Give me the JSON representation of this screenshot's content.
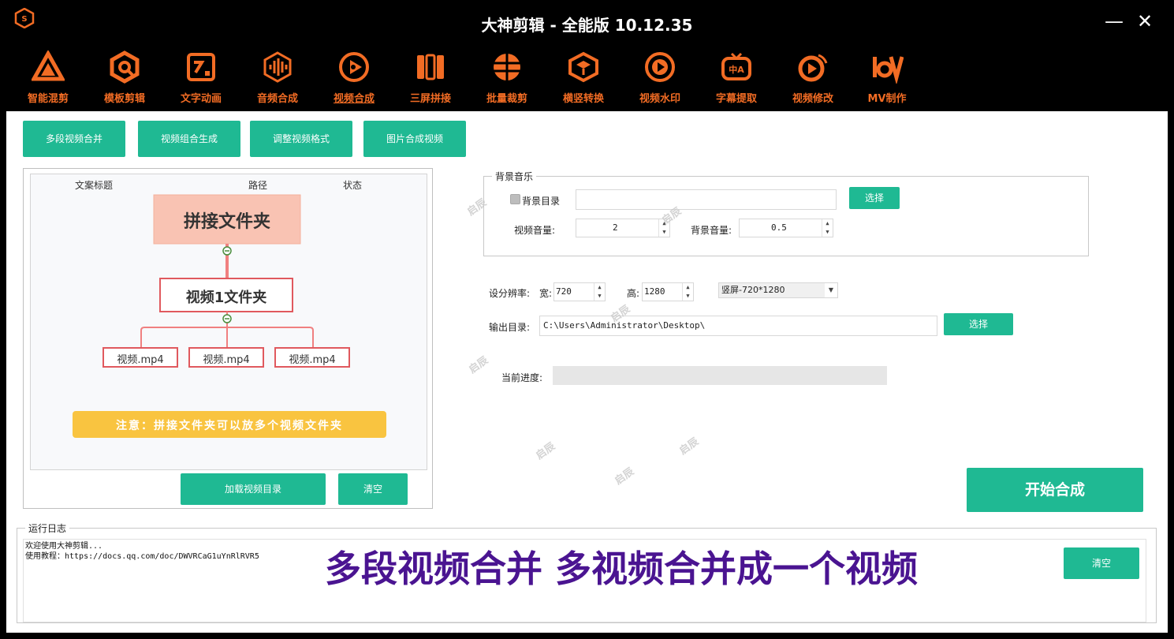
{
  "window": {
    "title": "大神剪辑 - 全能版 10.12.35",
    "minimize_label": "—",
    "close_label": "✕"
  },
  "toolbar": {
    "accent": "#f26c24",
    "items": [
      {
        "label": "智能混剪",
        "icon": "triangle-logo-icon"
      },
      {
        "label": "模板剪辑",
        "icon": "hexagon-q-icon"
      },
      {
        "label": "文字动画",
        "icon": "text-frame-icon"
      },
      {
        "label": "音频合成",
        "icon": "waveform-hexagon-icon"
      },
      {
        "label": "视频合成",
        "icon": "play-circle-icon",
        "active": true
      },
      {
        "label": "三屏拼接",
        "icon": "split-screen-icon"
      },
      {
        "label": "批量裁剪",
        "icon": "crop-globe-icon"
      },
      {
        "label": "横竖转换",
        "icon": "rotate-cube-icon"
      },
      {
        "label": "视频水印",
        "icon": "watermark-play-icon"
      },
      {
        "label": "字幕提取",
        "icon": "subtitle-tv-icon"
      },
      {
        "label": "视频修改",
        "icon": "video-edit-icon"
      },
      {
        "label": "MV制作",
        "icon": "mv-text-icon"
      }
    ]
  },
  "tabs": [
    {
      "label": "多段视频合并"
    },
    {
      "label": "视频组合生成"
    },
    {
      "label": "调整视频格式"
    },
    {
      "label": "图片合成视频"
    }
  ],
  "file_list": {
    "columns": [
      "文案标题",
      "路径",
      "状态"
    ],
    "guide": {
      "top_folder": "拼接文件夹",
      "sub_folder": "视频1文件夹",
      "files": [
        "视频.mp4",
        "视频.mp4",
        "视频.mp4"
      ],
      "note": "注意：拼接文件夹可以放多个视频文件夹"
    },
    "load_button": "加载视频目录",
    "clear_button": "清空"
  },
  "bg_music": {
    "group_title": "背景音乐",
    "dir_label": "背景目录",
    "dir_value": "",
    "select_button": "选择",
    "video_volume_label": "视频音量:",
    "video_volume": "2",
    "bg_volume_label": "背景音量:",
    "bg_volume": "0.5"
  },
  "resolution": {
    "label": "设分辨率:",
    "width_label": "宽:",
    "width": "720",
    "height_label": "高:",
    "height": "1280",
    "preset": "竖屏-720*1280"
  },
  "output": {
    "label": "输出目录:",
    "path": "C:\\Users\\Administrator\\Desktop\\",
    "select_button": "选择"
  },
  "progress": {
    "label": "当前进度:",
    "value": 0
  },
  "start_button": "开始合成",
  "log": {
    "group_title": "运行日志",
    "lines": "欢迎使用大神剪辑...\n使用教程：https://docs.qq.com/doc/DWVRCaG1uYnRlRVR5",
    "clear_button": "清空"
  },
  "caption": "多段视频合并 多视频合并成一个视频",
  "watermark": "启辰",
  "colors": {
    "accent_green": "#1fb993",
    "toolbar_orange": "#f26c24",
    "caption_purple": "#4a1491"
  }
}
